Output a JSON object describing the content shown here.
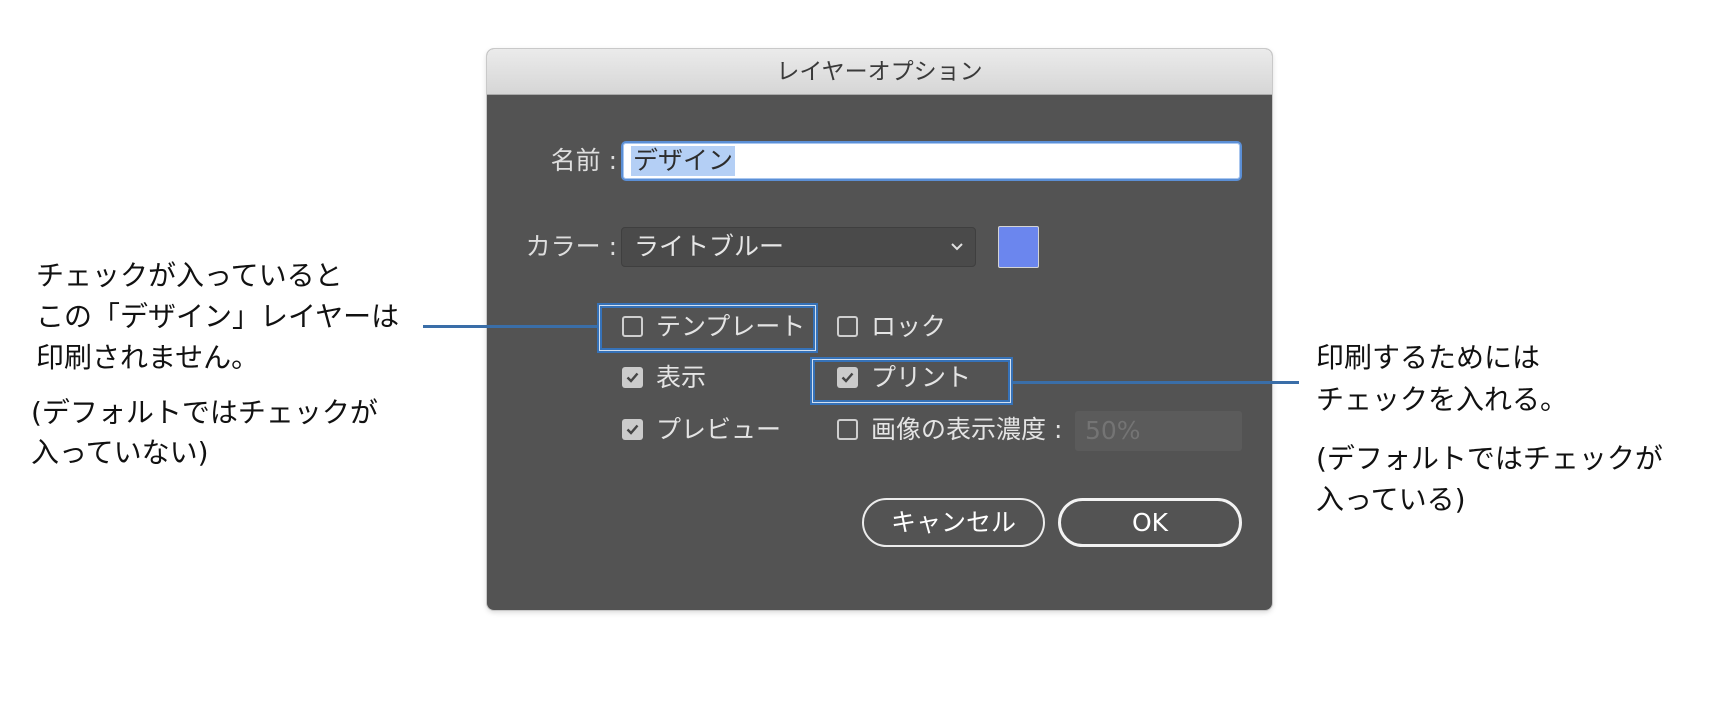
{
  "window": {
    "title": "レイヤーオプション"
  },
  "name_field": {
    "label": "名前 :",
    "value": "デザイン"
  },
  "color_field": {
    "label": "カラー :",
    "selected": "ライトブルー",
    "swatch_color": "#6b86ee"
  },
  "options": {
    "template": {
      "label": "テンプレート",
      "checked": false
    },
    "lock": {
      "label": "ロック",
      "checked": false
    },
    "show": {
      "label": "表示",
      "checked": true
    },
    "print": {
      "label": "プリント",
      "checked": true
    },
    "preview": {
      "label": "プレビュー",
      "checked": true
    },
    "dim_images": {
      "label": "画像の表示濃度 :",
      "checked": false,
      "value": "50%"
    }
  },
  "buttons": {
    "cancel": "キャンセル",
    "ok": "OK"
  },
  "annotations": {
    "left": {
      "lines": [
        "チェックが入っていると",
        "この「デザイン」レイヤーは",
        "印刷されません。"
      ],
      "note": [
        "(デフォルトではチェックが",
        "入っていない)"
      ]
    },
    "right": {
      "lines": [
        "印刷するためには",
        "チェックを入れる。"
      ],
      "note": [
        "(デフォルトではチェックが",
        "入っている)"
      ]
    }
  },
  "colors": {
    "highlight": "#3672b8",
    "dialog_bg": "#535353"
  }
}
